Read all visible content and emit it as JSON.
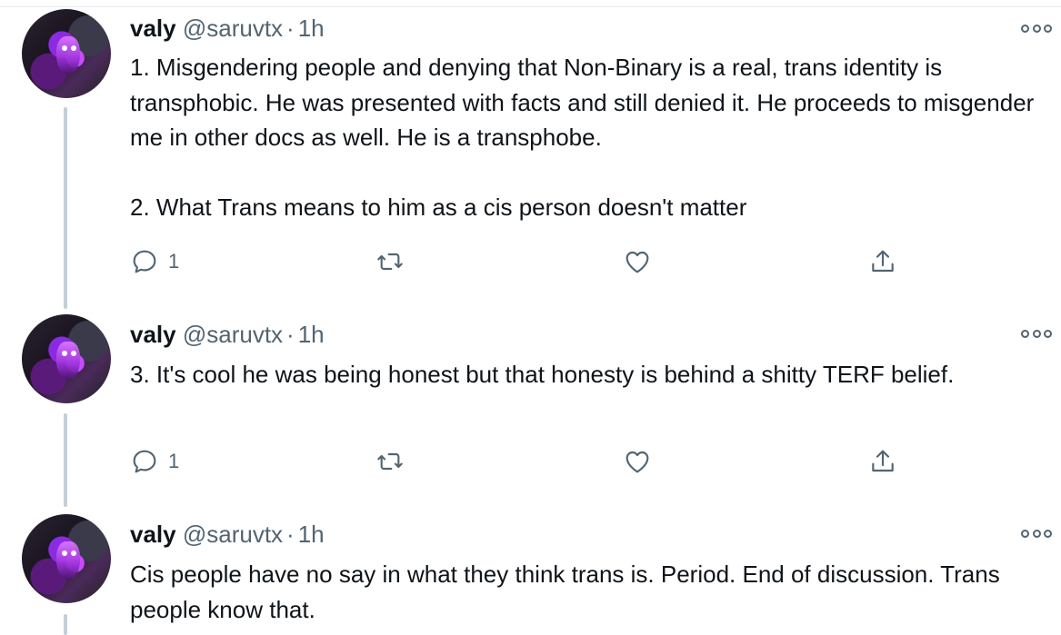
{
  "author": {
    "name": "valy",
    "handle": "@saruvtx",
    "separator": "·"
  },
  "tweets": [
    {
      "time": "1h",
      "text": "1. Misgendering people and denying that Non-Binary is a real, trans identity is transphobic. He was presented with facts and still denied it. He proceeds to misgender me in other docs as well. He is a transphobe.\n\n2. What Trans means to him as a cis person doesn't matter",
      "reply_count": "1"
    },
    {
      "time": "1h",
      "text": "3. It's cool he was being honest but that honesty is behind a shitty TERF belief.",
      "reply_count": "1"
    },
    {
      "time": "1h",
      "text": "Cis people have no say in what they think trans is. Period. End of discussion. Trans people know that."
    }
  ],
  "icons": {
    "reply": "reply-icon",
    "retweet": "retweet-icon",
    "like": "like-icon",
    "share": "share-icon",
    "more": "more-icon"
  },
  "colors": {
    "text": "#0f1419",
    "secondary": "#536471",
    "thread_line": "#c4cfd6"
  }
}
